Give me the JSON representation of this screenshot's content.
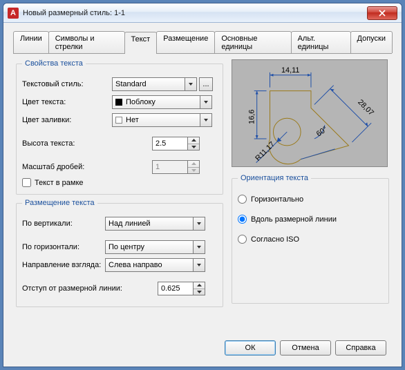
{
  "window": {
    "title": "Новый размерный стиль: 1-1"
  },
  "tabs": [
    "Линии",
    "Символы и стрелки",
    "Текст",
    "Размещение",
    "Основные единицы",
    "Альт. единицы",
    "Допуски"
  ],
  "active_tab": 2,
  "text_props": {
    "legend": "Свойства текста",
    "style_label": "Текстовый стиль:",
    "style_value": "Standard",
    "color_label": "Цвет текста:",
    "color_value": "Поблоку",
    "fill_label": "Цвет заливки:",
    "fill_value": "Нет",
    "height_label": "Высота текста:",
    "height_value": "2.5",
    "fraction_label": "Масштаб дробей:",
    "fraction_value": "1",
    "frame_label": "Текст в рамке"
  },
  "placement": {
    "legend": "Размещение текста",
    "vert_label": "По вертикали:",
    "vert_value": "Над линией",
    "horiz_label": "По горизонтали:",
    "horiz_value": "По центру",
    "dir_label": "Направление взгляда:",
    "dir_value": "Слева направо",
    "offset_label": "Отступ от размерной линии:",
    "offset_value": "0.625"
  },
  "orientation": {
    "legend": "Ориентация текста",
    "horiz": "Горизонтально",
    "along": "Вдоль размерной линии",
    "iso": "Согласно ISO",
    "selected": "along"
  },
  "preview_labels": {
    "top": "14,11",
    "left": "16,6",
    "right": "28,07",
    "radius": "R11,17",
    "angle": "60°"
  },
  "buttons": {
    "ok": "ОК",
    "cancel": "Отмена",
    "help": "Справка",
    "ellipsis": "..."
  }
}
